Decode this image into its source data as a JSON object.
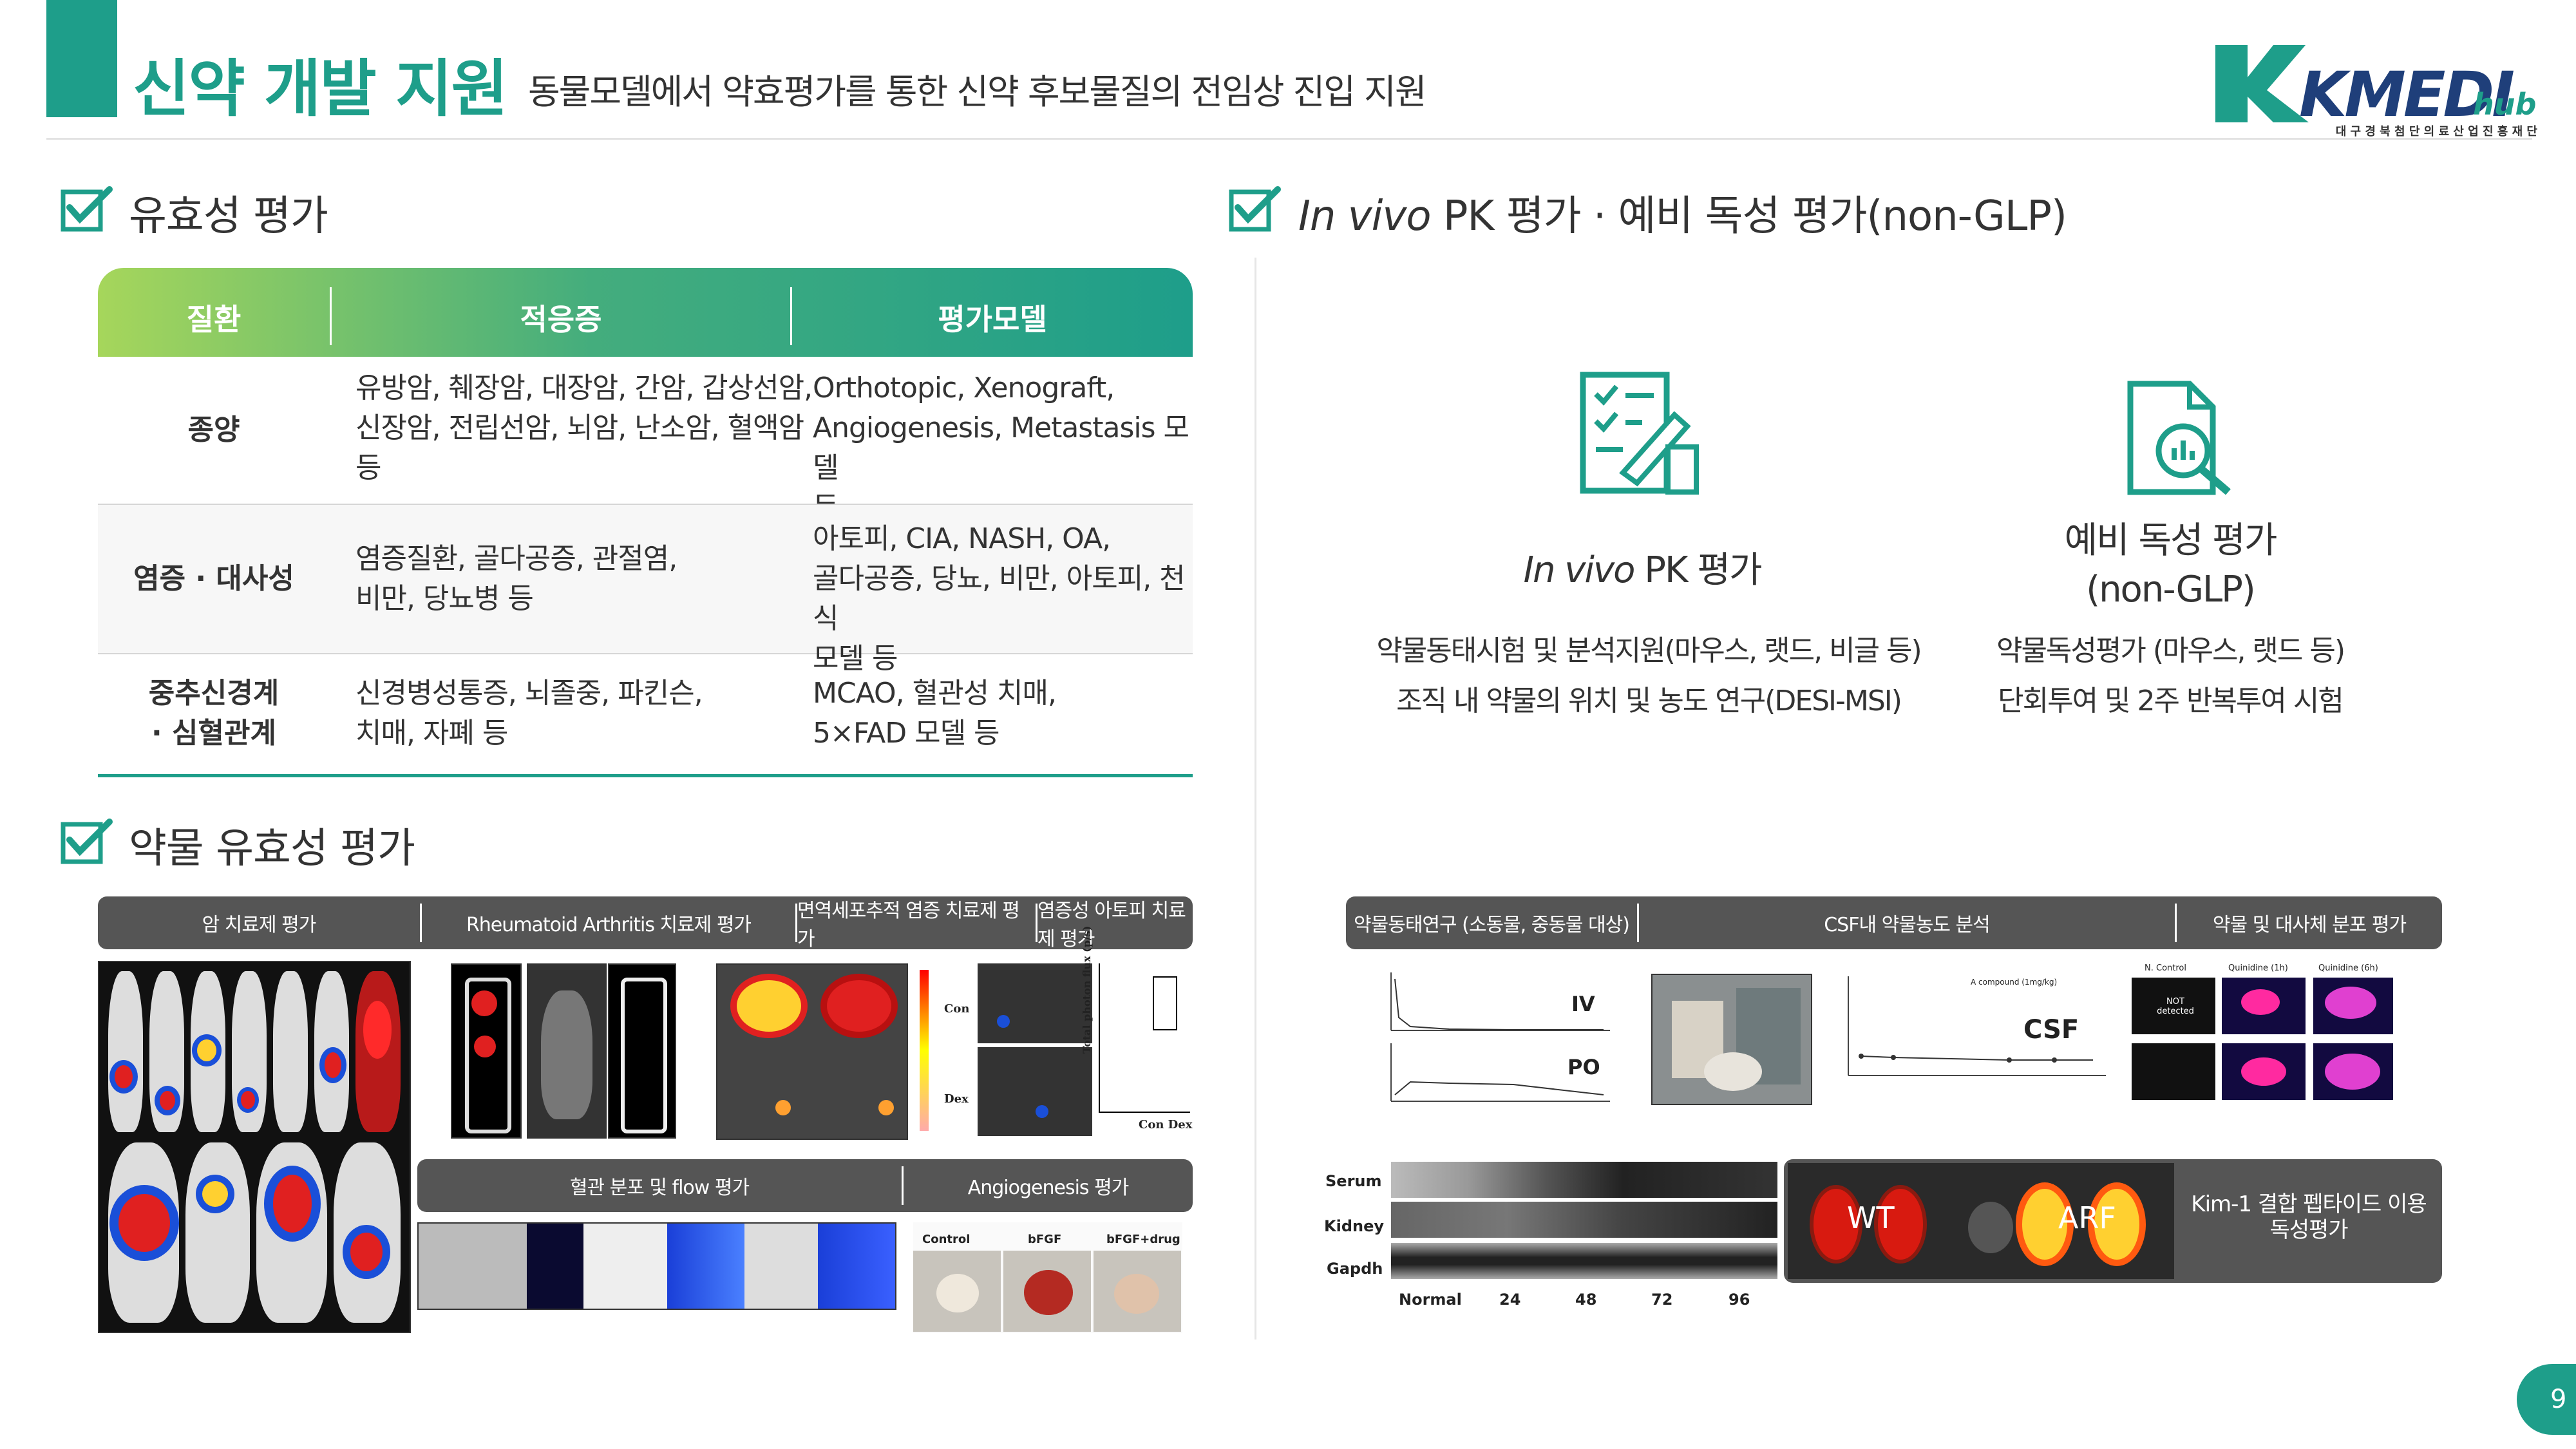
{
  "header": {
    "title": "신약 개발 지원",
    "subtitle": "동물모델에서 약효평가를 통한 신약 후보물질의 전임상 진입 지원",
    "logo_main": "KMEDI",
    "logo_hub": "hub",
    "logo_sub": "대 구 경 북 첨 단 의 료 산 업 진 흥 재 단"
  },
  "efficacy": {
    "title": "유효성 평가",
    "columns": [
      "질환",
      "적응증",
      "평가모델"
    ],
    "rows": [
      {
        "disease": [
          "종양"
        ],
        "indication": [
          "유방암, 췌장암, 대장암, 간암, 갑상선암,",
          "신장암, 전립선암, 뇌암, 난소암, 혈액암",
          "등"
        ],
        "model": [
          "Orthotopic, Xenograft,",
          "Angiogenesis, Metastasis 모델",
          "등"
        ]
      },
      {
        "disease": [
          "염증 · 대사성"
        ],
        "indication": [
          "염증질환, 골다공증, 관절염,",
          "비만, 당뇨병 등"
        ],
        "model": [
          "아토피, CIA, NASH, OA,",
          "골다공증, 당뇨, 비만, 아토피, 천식",
          "모델 등"
        ]
      },
      {
        "disease": [
          "중추신경계",
          "· 심혈관계"
        ],
        "indication": [
          "신경병성통증, 뇌졸중, 파킨슨,",
          "치매, 자폐 등"
        ],
        "model": [
          "MCAO, 혈관성 치매,",
          "5×FAD 모델 등"
        ]
      }
    ]
  },
  "drug_efficacy": {
    "title": "약물 유효성 평가",
    "tabs": [
      "암 치료제 평가",
      "Rheumatoid Arthritis 치료제 평가",
      "면역세포추적 염증 치료제 평가",
      "염증성 아토피 치료제 평가"
    ],
    "tabs2": [
      "혈관 분포 및 flow 평가",
      "Angiogenesis 평가"
    ],
    "angio_labels": [
      "Control",
      "bFGF",
      "bFGF+drug"
    ],
    "atopy_labels": [
      "Con",
      "Dex"
    ],
    "atopy_axis": "Total photon flux (p/s)",
    "atopy_x": "Con  Dex"
  },
  "pk": {
    "title_italic": "In vivo",
    "title_rest": " PK 평가 · 예비 독성 평가(non-GLP)",
    "item1_italic": "In vivo",
    "item1_rest": " PK 평가",
    "item1_desc": [
      "약물동태시험 및 분석지원(마우스, 랫드, 비글 등)",
      "조직 내 약물의 위치 및 농도 연구(DESI-MSI)"
    ],
    "item2_title": [
      "예비 독성 평가",
      "(non-GLP)"
    ],
    "item2_desc": [
      "약물독성평가 (마우스, 랫드 등)",
      "단회투여 및 2주 반복투여 시험"
    ],
    "tabs": [
      "약물동태연구 (소동물, 중동물 대상)",
      "CSF내 약물농도 분석",
      "약물 및 대사체 분포 평가"
    ],
    "iv": "IV",
    "po": "PO",
    "csf": "CSF",
    "csf_legend": "A compound (1mg/kg)",
    "dist_labels": [
      "N. Control",
      "Quinidine (1h)",
      "Quinidine (6h)"
    ],
    "not_detected": "NOT detected",
    "wb_rows": [
      "Serum",
      "Kidney",
      "Gapdh"
    ],
    "wb_cols": [
      "Normal",
      "24",
      "48",
      "72",
      "96"
    ],
    "wt": "WT",
    "arf": "ARF",
    "kim_text": [
      "Kim-1 결합 펩타이드 이용",
      "독성평가"
    ]
  },
  "page_number": "9",
  "colors": {
    "accent": "#1e9e8a",
    "gradient_start": "#a6d65b",
    "tab_bar": "#555555"
  }
}
